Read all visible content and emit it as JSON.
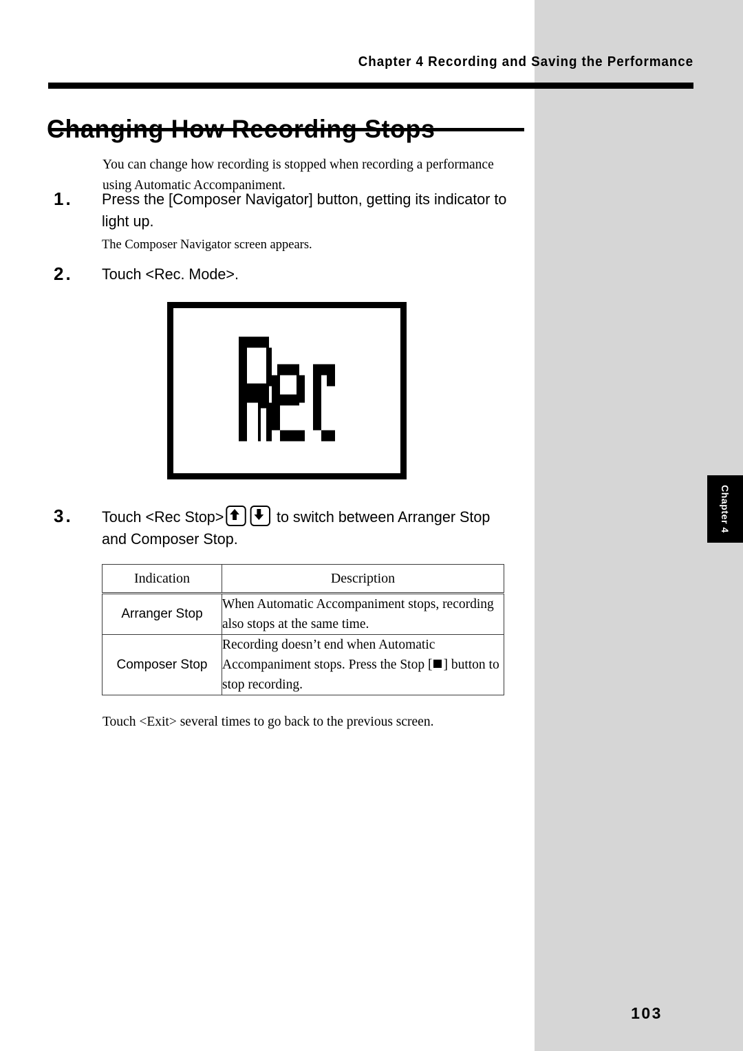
{
  "page": {
    "running_header": "Chapter 4 Recording and Saving the Performance",
    "section_title": "Changing How Recording Stops",
    "intro": "You can change how recording is stopped when recording a performance using Automatic Accompaniment.",
    "page_number": "103",
    "chapter_tab_label": "Chapter 4",
    "colors": {
      "sidebar_gray": "#d6d6d6",
      "ink": "#000000",
      "table_border": "#3b3b3b"
    }
  },
  "steps": [
    {
      "number": "1.",
      "text": "Press the [Composer Navigator] button, getting its indicator to light up.",
      "sub": "The Composer Navigator screen appears."
    },
    {
      "number": "2.",
      "text": "Touch <Rec. Mode>."
    },
    {
      "number": "3.",
      "text_before": "Touch <Rec Stop>",
      "text_after": "to switch between  Arranger Stop  and  Composer Stop.",
      "buttons": [
        {
          "name": "up-arrow-button",
          "glyph": "arrow-up"
        },
        {
          "name": "down-arrow-button",
          "glyph": "arrow-down"
        }
      ]
    }
  ],
  "lcd_figure": {
    "caption": "Rec",
    "display_text": "Rec"
  },
  "table": {
    "headers": [
      "Indication",
      "Description"
    ],
    "rows": [
      {
        "indication": "Arranger Stop",
        "description": "When Automatic Accompaniment stops, recording also stops at the same time."
      },
      {
        "indication": "Composer Stop",
        "description_before": "Recording doesn’t end when Automatic Accompaniment stops. Press the Stop [",
        "description_after": "] button to stop recording.",
        "stop_icon": "square-stop-icon"
      }
    ]
  },
  "closing_note": "Touch <Exit> several times to go back to the previous screen."
}
